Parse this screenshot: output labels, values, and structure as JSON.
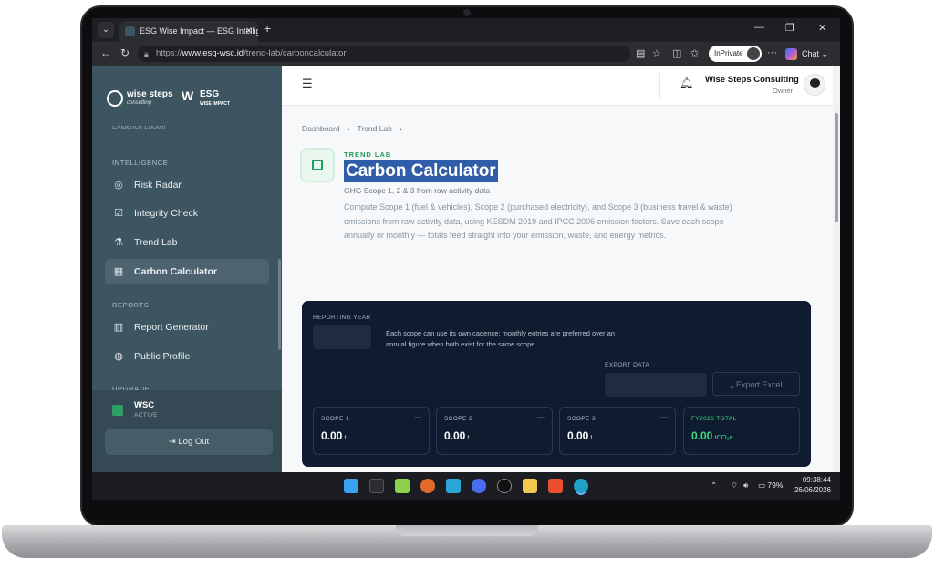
{
  "browser": {
    "tab_title": "ESG Wise Impact — ESG Intelligen",
    "url_prefix": "https://",
    "url_host": "www.esg-wsc.id",
    "url_path": "/trend-lab/carboncalculator",
    "inprivate_label": "InPrivate",
    "chat_label": "Chat"
  },
  "brand": {
    "wise_steps": "wise steps",
    "consulting": "consulting",
    "esg": "ESG",
    "wise_impact": "WISE IMPACT"
  },
  "sidebar": {
    "partial_item": "Evidence Locker",
    "intelligence_label": "INTELLIGENCE",
    "items": [
      {
        "label": "Risk Radar",
        "icon": "radar-icon"
      },
      {
        "label": "Integrity Check",
        "icon": "checklist-icon"
      },
      {
        "label": "Trend Lab",
        "icon": "flask-icon"
      },
      {
        "label": "Carbon Calculator",
        "icon": "calculator-icon"
      }
    ],
    "reports_label": "REPORTS",
    "report_items": [
      {
        "label": "Report Generator",
        "icon": "bar-chart-icon"
      },
      {
        "label": "Public Profile",
        "icon": "globe-icon"
      }
    ],
    "upgrade_label": "UPGRADE",
    "plan_name": "WSC",
    "plan_status": "ACTIVE",
    "logout_label": "Log Out"
  },
  "header": {
    "company": "Wise Steps Consulting",
    "role": "Owner"
  },
  "breadcrumb": [
    "Dashboard",
    "Trend Lab"
  ],
  "page": {
    "kicker": "TREND LAB",
    "title": "Carbon Calculator",
    "subtitle": "GHG Scope 1, 2 & 3 from raw activity data",
    "description": "Compute Scope 1 (fuel & vehicles), Scope 2 (purchased electricity), and Scope 3 (business travel & waste) emissions from raw activity data, using KESDM 2019 and IPCC 2006 emission factors. Save each scope annually or monthly — totals feed straight into your emission, waste, and energy metrics."
  },
  "panel": {
    "reporting_year_label": "REPORTING YEAR",
    "note": "Each scope can use its own cadence; monthly entries are preferred over an annual figure when both exist for the same scope.",
    "export_label": "EXPORT DATA",
    "export_button": "Export Excel",
    "cards": [
      {
        "label": "SCOPE 1",
        "value": "0.00",
        "unit": "t",
        "dash": "—"
      },
      {
        "label": "SCOPE 2",
        "value": "0.00",
        "unit": "t",
        "dash": "—"
      },
      {
        "label": "SCOPE 3",
        "value": "0.00",
        "unit": "t",
        "dash": "—"
      },
      {
        "label": "FY2026 TOTAL",
        "value": "0.00",
        "unit": "tCO₂e"
      }
    ]
  },
  "taskbar": {
    "battery": "79%",
    "time": "09:38:44",
    "date": "26/06/2026"
  }
}
